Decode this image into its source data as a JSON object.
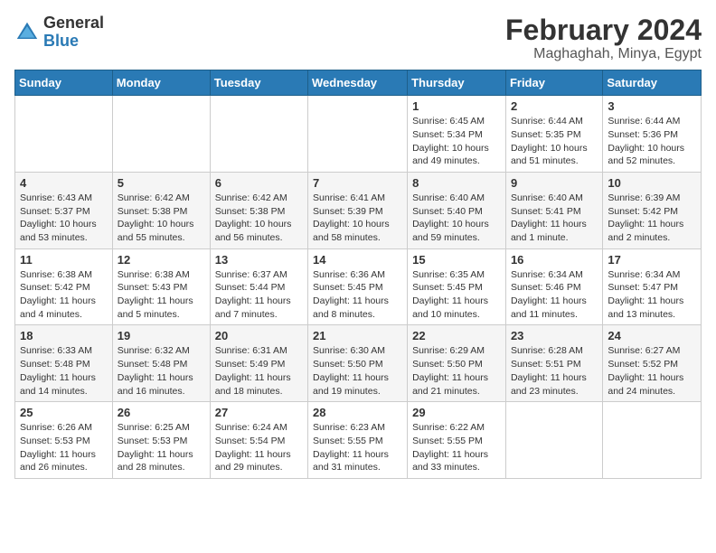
{
  "logo": {
    "general": "General",
    "blue": "Blue"
  },
  "title": "February 2024",
  "subtitle": "Maghaghah, Minya, Egypt",
  "days_header": [
    "Sunday",
    "Monday",
    "Tuesday",
    "Wednesday",
    "Thursday",
    "Friday",
    "Saturday"
  ],
  "weeks": [
    [
      {
        "day": "",
        "info": ""
      },
      {
        "day": "",
        "info": ""
      },
      {
        "day": "",
        "info": ""
      },
      {
        "day": "",
        "info": ""
      },
      {
        "day": "1",
        "info": "Sunrise: 6:45 AM\nSunset: 5:34 PM\nDaylight: 10 hours and 49 minutes."
      },
      {
        "day": "2",
        "info": "Sunrise: 6:44 AM\nSunset: 5:35 PM\nDaylight: 10 hours and 51 minutes."
      },
      {
        "day": "3",
        "info": "Sunrise: 6:44 AM\nSunset: 5:36 PM\nDaylight: 10 hours and 52 minutes."
      }
    ],
    [
      {
        "day": "4",
        "info": "Sunrise: 6:43 AM\nSunset: 5:37 PM\nDaylight: 10 hours and 53 minutes."
      },
      {
        "day": "5",
        "info": "Sunrise: 6:42 AM\nSunset: 5:38 PM\nDaylight: 10 hours and 55 minutes."
      },
      {
        "day": "6",
        "info": "Sunrise: 6:42 AM\nSunset: 5:38 PM\nDaylight: 10 hours and 56 minutes."
      },
      {
        "day": "7",
        "info": "Sunrise: 6:41 AM\nSunset: 5:39 PM\nDaylight: 10 hours and 58 minutes."
      },
      {
        "day": "8",
        "info": "Sunrise: 6:40 AM\nSunset: 5:40 PM\nDaylight: 10 hours and 59 minutes."
      },
      {
        "day": "9",
        "info": "Sunrise: 6:40 AM\nSunset: 5:41 PM\nDaylight: 11 hours and 1 minute."
      },
      {
        "day": "10",
        "info": "Sunrise: 6:39 AM\nSunset: 5:42 PM\nDaylight: 11 hours and 2 minutes."
      }
    ],
    [
      {
        "day": "11",
        "info": "Sunrise: 6:38 AM\nSunset: 5:42 PM\nDaylight: 11 hours and 4 minutes."
      },
      {
        "day": "12",
        "info": "Sunrise: 6:38 AM\nSunset: 5:43 PM\nDaylight: 11 hours and 5 minutes."
      },
      {
        "day": "13",
        "info": "Sunrise: 6:37 AM\nSunset: 5:44 PM\nDaylight: 11 hours and 7 minutes."
      },
      {
        "day": "14",
        "info": "Sunrise: 6:36 AM\nSunset: 5:45 PM\nDaylight: 11 hours and 8 minutes."
      },
      {
        "day": "15",
        "info": "Sunrise: 6:35 AM\nSunset: 5:45 PM\nDaylight: 11 hours and 10 minutes."
      },
      {
        "day": "16",
        "info": "Sunrise: 6:34 AM\nSunset: 5:46 PM\nDaylight: 11 hours and 11 minutes."
      },
      {
        "day": "17",
        "info": "Sunrise: 6:34 AM\nSunset: 5:47 PM\nDaylight: 11 hours and 13 minutes."
      }
    ],
    [
      {
        "day": "18",
        "info": "Sunrise: 6:33 AM\nSunset: 5:48 PM\nDaylight: 11 hours and 14 minutes."
      },
      {
        "day": "19",
        "info": "Sunrise: 6:32 AM\nSunset: 5:48 PM\nDaylight: 11 hours and 16 minutes."
      },
      {
        "day": "20",
        "info": "Sunrise: 6:31 AM\nSunset: 5:49 PM\nDaylight: 11 hours and 18 minutes."
      },
      {
        "day": "21",
        "info": "Sunrise: 6:30 AM\nSunset: 5:50 PM\nDaylight: 11 hours and 19 minutes."
      },
      {
        "day": "22",
        "info": "Sunrise: 6:29 AM\nSunset: 5:50 PM\nDaylight: 11 hours and 21 minutes."
      },
      {
        "day": "23",
        "info": "Sunrise: 6:28 AM\nSunset: 5:51 PM\nDaylight: 11 hours and 23 minutes."
      },
      {
        "day": "24",
        "info": "Sunrise: 6:27 AM\nSunset: 5:52 PM\nDaylight: 11 hours and 24 minutes."
      }
    ],
    [
      {
        "day": "25",
        "info": "Sunrise: 6:26 AM\nSunset: 5:53 PM\nDaylight: 11 hours and 26 minutes."
      },
      {
        "day": "26",
        "info": "Sunrise: 6:25 AM\nSunset: 5:53 PM\nDaylight: 11 hours and 28 minutes."
      },
      {
        "day": "27",
        "info": "Sunrise: 6:24 AM\nSunset: 5:54 PM\nDaylight: 11 hours and 29 minutes."
      },
      {
        "day": "28",
        "info": "Sunrise: 6:23 AM\nSunset: 5:55 PM\nDaylight: 11 hours and 31 minutes."
      },
      {
        "day": "29",
        "info": "Sunrise: 6:22 AM\nSunset: 5:55 PM\nDaylight: 11 hours and 33 minutes."
      },
      {
        "day": "",
        "info": ""
      },
      {
        "day": "",
        "info": ""
      }
    ]
  ]
}
